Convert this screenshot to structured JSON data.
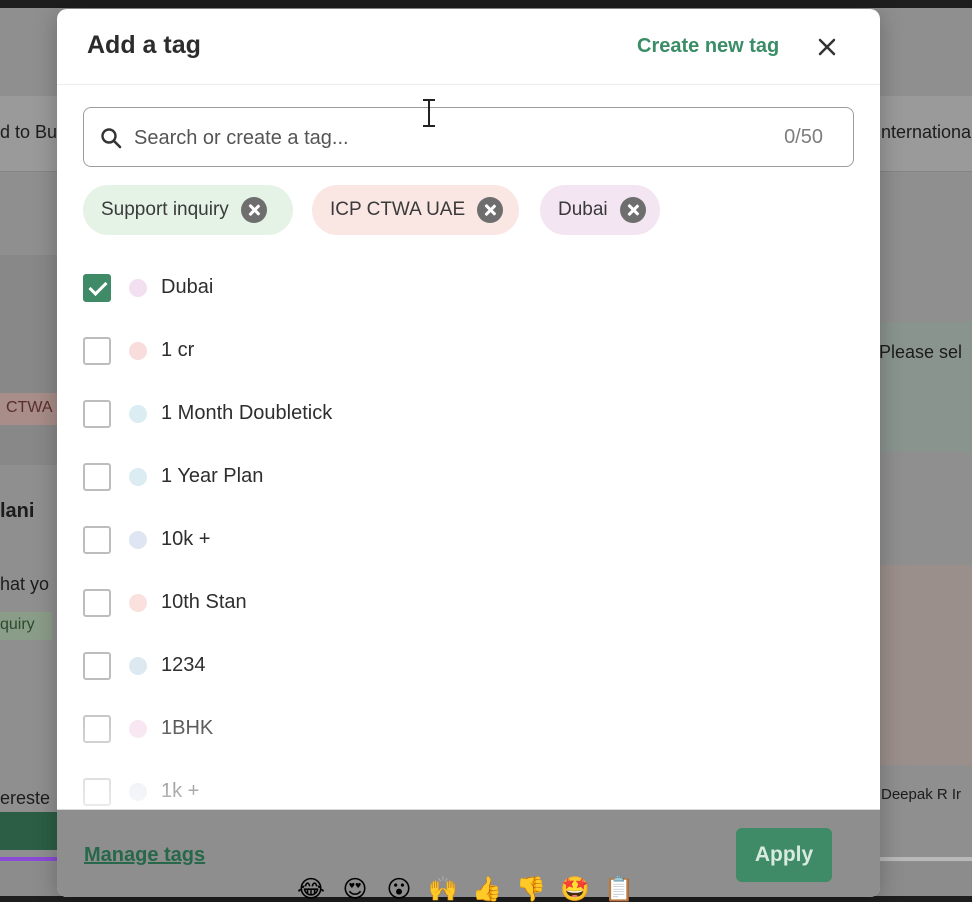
{
  "background": {
    "left_texts": [
      "d to Bu",
      "CTWA",
      "lani",
      "hat yo",
      "quiry",
      "ereste"
    ],
    "right_texts": [
      "nternationa",
      "Please sel",
      "Deepak R Ir"
    ]
  },
  "modal": {
    "title": "Add a tag",
    "create_link": "Create new tag",
    "close_icon": "close-icon",
    "search": {
      "placeholder": "Search or create a tag...",
      "value": "",
      "count": "0/50"
    },
    "selected_tags": [
      {
        "label": "Support inquiry",
        "color": "#e4f3e6"
      },
      {
        "label": "ICP CTWA UAE",
        "color": "#fae7e4"
      },
      {
        "label": "Dubai",
        "color": "#f4e5f3"
      }
    ],
    "tags": [
      {
        "label": "Dubai",
        "checked": true,
        "dot": "#f2dff0"
      },
      {
        "label": "1 cr",
        "checked": false,
        "dot": "#f9dcdc"
      },
      {
        "label": "1 Month Doubletick",
        "checked": false,
        "dot": "#dcecf3"
      },
      {
        "label": "1 Year Plan",
        "checked": false,
        "dot": "#dcecf3"
      },
      {
        "label": "10k +",
        "checked": false,
        "dot": "#dfe5f2"
      },
      {
        "label": "10th Stan",
        "checked": false,
        "dot": "#fae1de"
      },
      {
        "label": "1234",
        "checked": false,
        "dot": "#dde9f1"
      },
      {
        "label": "1BHK",
        "checked": false,
        "dot": "#f6e0ee"
      },
      {
        "label": "1k +",
        "checked": false,
        "dot": "#dfe4ef"
      }
    ],
    "footer": {
      "manage_link": "Manage tags",
      "apply_label": "Apply"
    }
  },
  "video_bar": {
    "progress": 0.33
  },
  "reactions": [
    "😂",
    "😍",
    "😮",
    "🙌",
    "👍",
    "👎",
    "🤩",
    "📋"
  ],
  "colors": {
    "accent": "#3f8a67",
    "link": "#3a8d66"
  }
}
